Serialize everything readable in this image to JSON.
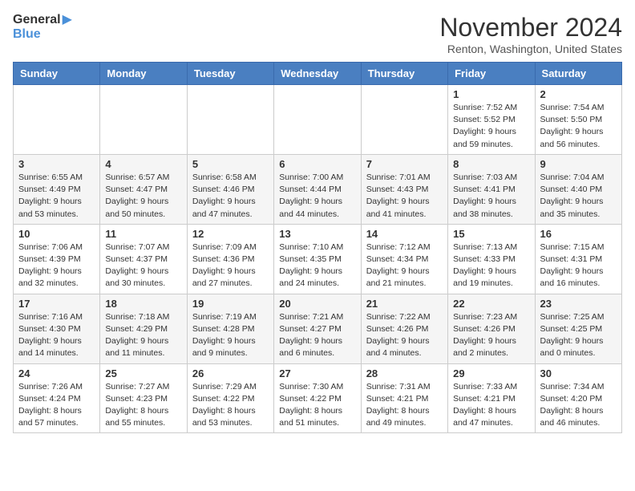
{
  "logo": {
    "general": "General",
    "blue": "Blue"
  },
  "title": "November 2024",
  "location": "Renton, Washington, United States",
  "days_of_week": [
    "Sunday",
    "Monday",
    "Tuesday",
    "Wednesday",
    "Thursday",
    "Friday",
    "Saturday"
  ],
  "weeks": [
    [
      {
        "day": "",
        "info": ""
      },
      {
        "day": "",
        "info": ""
      },
      {
        "day": "",
        "info": ""
      },
      {
        "day": "",
        "info": ""
      },
      {
        "day": "",
        "info": ""
      },
      {
        "day": "1",
        "info": "Sunrise: 7:52 AM\nSunset: 5:52 PM\nDaylight: 9 hours and 59 minutes."
      },
      {
        "day": "2",
        "info": "Sunrise: 7:54 AM\nSunset: 5:50 PM\nDaylight: 9 hours and 56 minutes."
      }
    ],
    [
      {
        "day": "3",
        "info": "Sunrise: 6:55 AM\nSunset: 4:49 PM\nDaylight: 9 hours and 53 minutes."
      },
      {
        "day": "4",
        "info": "Sunrise: 6:57 AM\nSunset: 4:47 PM\nDaylight: 9 hours and 50 minutes."
      },
      {
        "day": "5",
        "info": "Sunrise: 6:58 AM\nSunset: 4:46 PM\nDaylight: 9 hours and 47 minutes."
      },
      {
        "day": "6",
        "info": "Sunrise: 7:00 AM\nSunset: 4:44 PM\nDaylight: 9 hours and 44 minutes."
      },
      {
        "day": "7",
        "info": "Sunrise: 7:01 AM\nSunset: 4:43 PM\nDaylight: 9 hours and 41 minutes."
      },
      {
        "day": "8",
        "info": "Sunrise: 7:03 AM\nSunset: 4:41 PM\nDaylight: 9 hours and 38 minutes."
      },
      {
        "day": "9",
        "info": "Sunrise: 7:04 AM\nSunset: 4:40 PM\nDaylight: 9 hours and 35 minutes."
      }
    ],
    [
      {
        "day": "10",
        "info": "Sunrise: 7:06 AM\nSunset: 4:39 PM\nDaylight: 9 hours and 32 minutes."
      },
      {
        "day": "11",
        "info": "Sunrise: 7:07 AM\nSunset: 4:37 PM\nDaylight: 9 hours and 30 minutes."
      },
      {
        "day": "12",
        "info": "Sunrise: 7:09 AM\nSunset: 4:36 PM\nDaylight: 9 hours and 27 minutes."
      },
      {
        "day": "13",
        "info": "Sunrise: 7:10 AM\nSunset: 4:35 PM\nDaylight: 9 hours and 24 minutes."
      },
      {
        "day": "14",
        "info": "Sunrise: 7:12 AM\nSunset: 4:34 PM\nDaylight: 9 hours and 21 minutes."
      },
      {
        "day": "15",
        "info": "Sunrise: 7:13 AM\nSunset: 4:33 PM\nDaylight: 9 hours and 19 minutes."
      },
      {
        "day": "16",
        "info": "Sunrise: 7:15 AM\nSunset: 4:31 PM\nDaylight: 9 hours and 16 minutes."
      }
    ],
    [
      {
        "day": "17",
        "info": "Sunrise: 7:16 AM\nSunset: 4:30 PM\nDaylight: 9 hours and 14 minutes."
      },
      {
        "day": "18",
        "info": "Sunrise: 7:18 AM\nSunset: 4:29 PM\nDaylight: 9 hours and 11 minutes."
      },
      {
        "day": "19",
        "info": "Sunrise: 7:19 AM\nSunset: 4:28 PM\nDaylight: 9 hours and 9 minutes."
      },
      {
        "day": "20",
        "info": "Sunrise: 7:21 AM\nSunset: 4:27 PM\nDaylight: 9 hours and 6 minutes."
      },
      {
        "day": "21",
        "info": "Sunrise: 7:22 AM\nSunset: 4:26 PM\nDaylight: 9 hours and 4 minutes."
      },
      {
        "day": "22",
        "info": "Sunrise: 7:23 AM\nSunset: 4:26 PM\nDaylight: 9 hours and 2 minutes."
      },
      {
        "day": "23",
        "info": "Sunrise: 7:25 AM\nSunset: 4:25 PM\nDaylight: 9 hours and 0 minutes."
      }
    ],
    [
      {
        "day": "24",
        "info": "Sunrise: 7:26 AM\nSunset: 4:24 PM\nDaylight: 8 hours and 57 minutes."
      },
      {
        "day": "25",
        "info": "Sunrise: 7:27 AM\nSunset: 4:23 PM\nDaylight: 8 hours and 55 minutes."
      },
      {
        "day": "26",
        "info": "Sunrise: 7:29 AM\nSunset: 4:22 PM\nDaylight: 8 hours and 53 minutes."
      },
      {
        "day": "27",
        "info": "Sunrise: 7:30 AM\nSunset: 4:22 PM\nDaylight: 8 hours and 51 minutes."
      },
      {
        "day": "28",
        "info": "Sunrise: 7:31 AM\nSunset: 4:21 PM\nDaylight: 8 hours and 49 minutes."
      },
      {
        "day": "29",
        "info": "Sunrise: 7:33 AM\nSunset: 4:21 PM\nDaylight: 8 hours and 47 minutes."
      },
      {
        "day": "30",
        "info": "Sunrise: 7:34 AM\nSunset: 4:20 PM\nDaylight: 8 hours and 46 minutes."
      }
    ]
  ]
}
